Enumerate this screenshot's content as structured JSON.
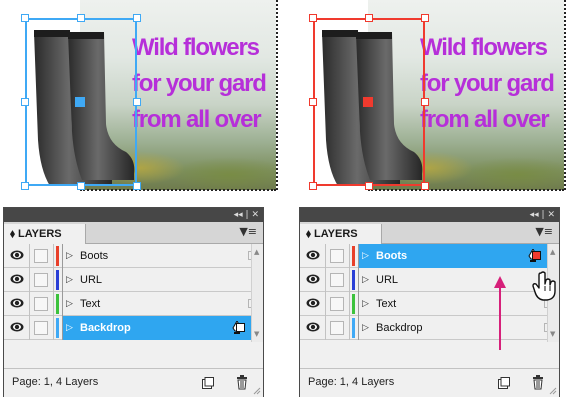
{
  "artwork": {
    "headline_lines": [
      "Wild flowers",
      "for your gard",
      "from all over"
    ]
  },
  "colors": {
    "headline": "#b62fd9",
    "left_selection": "#3fa9f5",
    "right_selection": "#f03a2e",
    "selected_row": "#2fa6f0",
    "drag_arrow": "#d6207a"
  },
  "panels": [
    {
      "tab_label": "⬧ LAYERS",
      "titlebar_buttons": "◂◂ | ✕",
      "menu_icon": "menu-icon",
      "layers": [
        {
          "name": "Boots",
          "color": "#e8402a",
          "selected": false
        },
        {
          "name": "URL",
          "color": "#2a3fd6",
          "selected": false
        },
        {
          "name": "Text",
          "color": "#3cc23c",
          "selected": false
        },
        {
          "name": "Backdrop",
          "color": "#3fa9f5",
          "selected": true
        }
      ],
      "status": "Page: 1, 4 Layers"
    },
    {
      "tab_label": "⬧ LAYERS",
      "titlebar_buttons": "◂◂ | ✕",
      "menu_icon": "menu-icon",
      "layers": [
        {
          "name": "Boots",
          "color": "#e8402a",
          "selected": true
        },
        {
          "name": "URL",
          "color": "#2a3fd6",
          "selected": false
        },
        {
          "name": "Text",
          "color": "#3cc23c",
          "selected": false
        },
        {
          "name": "Backdrop",
          "color": "#3fa9f5",
          "selected": false
        }
      ],
      "status": "Page: 1, 4 Layers"
    }
  ]
}
